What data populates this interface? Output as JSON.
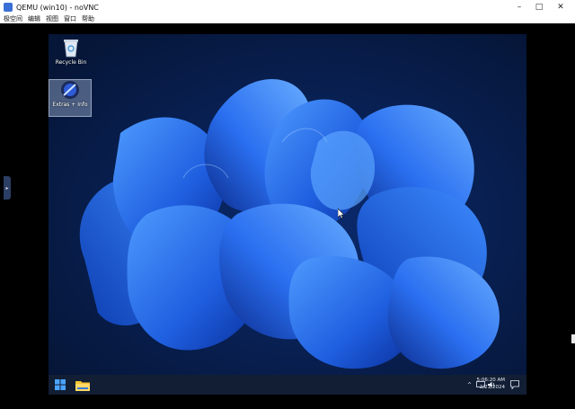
{
  "window": {
    "title": "QEMU (win10) - noVNC"
  },
  "menu": [
    "极空间",
    "编辑",
    "视图",
    "窗口",
    "帮助"
  ],
  "controls": {
    "minimize": "–",
    "maximize": "□",
    "close": "✕"
  },
  "desktop": {
    "icons": [
      {
        "label": "Recycle Bin",
        "icon": "recycle-bin-icon"
      },
      {
        "label": "Extras + Info",
        "icon": "extras-info-icon",
        "selected": true
      }
    ]
  },
  "taskbar": {
    "start_icon": "windows-start-icon",
    "explorer_icon": "file-explorer-icon",
    "tray": {
      "chevron": "^",
      "time": "5:06:20 AM",
      "date": "2/21/2024"
    }
  },
  "colors": {
    "accent": "#1f5fe0",
    "desktop_bg": "#071c47",
    "taskbar": "#141e32"
  }
}
